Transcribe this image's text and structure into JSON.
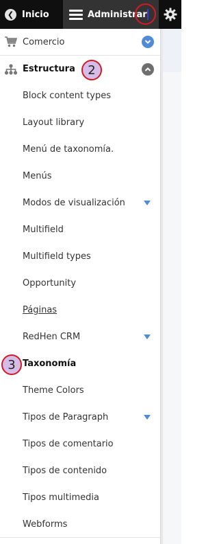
{
  "toolbar": {
    "home_label": "Inicio",
    "admin_label": "Administrar"
  },
  "menu": {
    "comercio": "Comercio",
    "estructura": "Estructura",
    "items": [
      "Block content types",
      "Layout library",
      "Menú de taxonomía.",
      "Menús",
      "Modos de visualización",
      "Multifield",
      "Multifield types",
      "Opportunity",
      "Páginas",
      "RedHen CRM",
      "Taxonomía",
      "Theme Colors",
      "Tipos de Paragraph",
      "Tipos de comentario",
      "Tipos de contenido",
      "Tipos multimedia",
      "Webforms"
    ]
  },
  "annotations": {
    "badge_2": "2",
    "badge_3": "3"
  },
  "colors": {
    "toolbar_bg": "#0f0f0f",
    "admin_tab_bg": "#333333",
    "accent_blue": "#4f8bd6",
    "annotation_red": "#d21a26",
    "annotation_fill": "#d5bde8"
  }
}
